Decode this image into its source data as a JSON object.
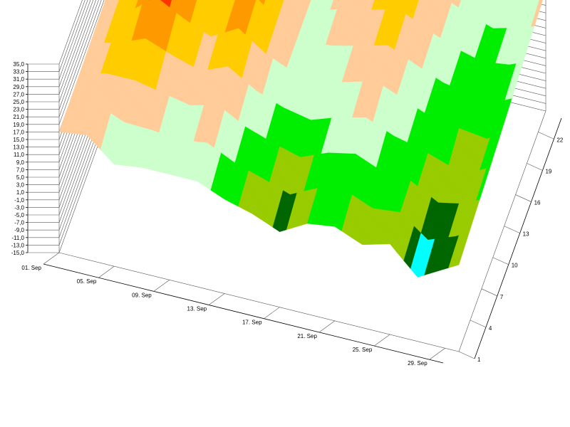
{
  "chart_data": {
    "type": "3d-surface",
    "z_axis": {
      "min": -15.0,
      "max": 35.0,
      "step": 2.0,
      "tick_labels": [
        "35,0",
        "33,0",
        "31,0",
        "29,0",
        "27,0",
        "25,0",
        "23,0",
        "21,0",
        "19,0",
        "17,0",
        "15,0",
        "13,0",
        "11,0",
        "9,0",
        "7,0",
        "5,0",
        "3,0",
        "1,0",
        "-1,0",
        "-3,0",
        "-5,0",
        "-7,0",
        "-9,0",
        "-11,0",
        "-13,0",
        "-15,0"
      ]
    },
    "x_axis": {
      "tick_labels": [
        "01. Sep",
        "05. Sep",
        "09. Sep",
        "13. Sep",
        "17. Sep",
        "21. Sep",
        "25. Sep",
        "29. Sep"
      ],
      "days": [
        1,
        5,
        9,
        13,
        17,
        21,
        25,
        29
      ],
      "range": [
        1,
        30
      ]
    },
    "y_axis": {
      "tick_labels": [
        "1",
        "4",
        "7",
        "10",
        "13",
        "16",
        "19",
        "22"
      ],
      "values": [
        1,
        4,
        7,
        10,
        13,
        16,
        19,
        22
      ],
      "range": [
        1,
        24
      ]
    },
    "grid": true,
    "color_bands": [
      {
        "from": -15,
        "to": 1,
        "color": "#ccffff"
      },
      {
        "from": 1,
        "to": 4,
        "color": "#00ffff"
      },
      {
        "from": 4,
        "to": 7,
        "color": "#006600"
      },
      {
        "from": 7,
        "to": 10,
        "color": "#99cc00"
      },
      {
        "from": 10,
        "to": 13,
        "color": "#00ee00"
      },
      {
        "from": 13,
        "to": 16,
        "color": "#ccffcc"
      },
      {
        "from": 16,
        "to": 19,
        "color": "#ffcc99"
      },
      {
        "from": 19,
        "to": 22,
        "color": "#ffcc00"
      },
      {
        "from": 22,
        "to": 25,
        "color": "#ff9900"
      },
      {
        "from": 25,
        "to": 28,
        "color": "#ff3300"
      },
      {
        "from": 28,
        "to": 31,
        "color": "#ffff99"
      },
      {
        "from": 31,
        "to": 35,
        "color": "#ff99cc"
      }
    ],
    "surface": {
      "hours": [
        1,
        12,
        24
      ],
      "rows": [
        {
          "day": 1,
          "values": [
            17,
            18,
            19
          ]
        },
        {
          "day": 3,
          "values": [
            18,
            20,
            21
          ]
        },
        {
          "day": 5,
          "values": [
            12,
            26,
            31
          ]
        },
        {
          "day": 7,
          "values": [
            13,
            22,
            33
          ]
        },
        {
          "day": 9,
          "values": [
            13,
            19,
            21
          ]
        },
        {
          "day": 11,
          "values": [
            13,
            23,
            30
          ]
        },
        {
          "day": 13,
          "values": [
            10,
            18,
            21
          ]
        },
        {
          "day": 15,
          "values": [
            8,
            15,
            14
          ]
        },
        {
          "day": 17,
          "values": [
            5,
            14,
            20
          ]
        },
        {
          "day": 19,
          "values": [
            9,
            16,
            21
          ]
        },
        {
          "day": 21,
          "values": [
            10,
            18,
            23
          ]
        },
        {
          "day": 23,
          "values": [
            7,
            15,
            19
          ]
        },
        {
          "day": 25,
          "values": [
            9,
            12,
            16
          ]
        },
        {
          "day": 27,
          "values": [
            2,
            11,
            13
          ]
        },
        {
          "day": 29,
          "values": [
            6,
            10,
            16
          ]
        },
        {
          "day": 30,
          "values": [
            8,
            12,
            17
          ]
        }
      ]
    }
  }
}
